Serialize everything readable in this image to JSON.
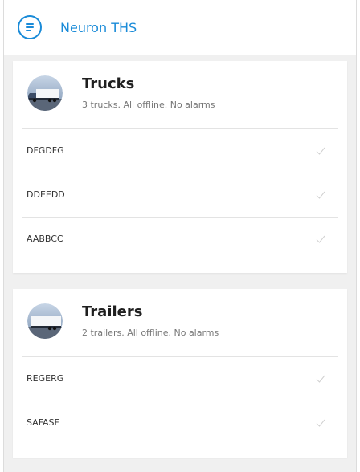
{
  "app": {
    "title": "Neuron THS"
  },
  "groups": [
    {
      "title": "Trucks",
      "summary": "3 trucks. All offline. No alarms",
      "icon": "truck-icon",
      "items": [
        {
          "label": "DFGDFG"
        },
        {
          "label": "DDEEDD"
        },
        {
          "label": "AABBCC"
        }
      ]
    },
    {
      "title": "Trailers",
      "summary": "2 trailers. All offline. No alarms",
      "icon": "trailer-icon",
      "items": [
        {
          "label": "REGERG"
        },
        {
          "label": "SAFASF"
        }
      ]
    }
  ],
  "colors": {
    "accent": "#1a8bd8",
    "background": "#f0f0f0",
    "check": "#d0d0d0"
  }
}
